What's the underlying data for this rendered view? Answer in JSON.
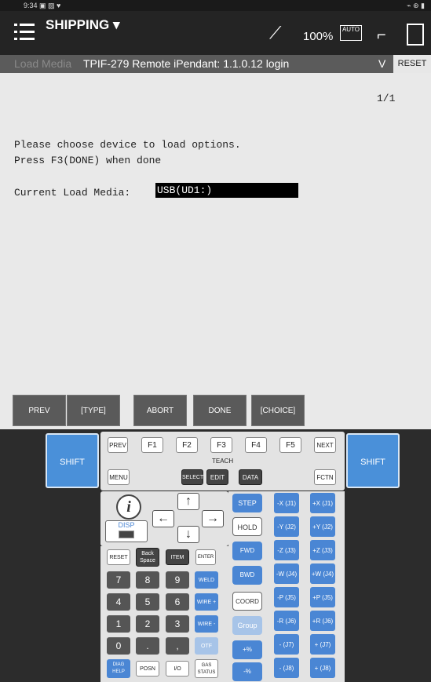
{
  "status_bar": {
    "time": "9:34",
    "left_icons": "▣ ▨ ♥",
    "right_icons": "⌁ ⊛ ▮"
  },
  "header": {
    "program": "SHIPPING",
    "override": "100%",
    "auto_label": "AUTO"
  },
  "subheader": {
    "menu_label": "Load Media",
    "title": "TPIF-279  Remote iPendant: 1.1.0.12 login",
    "dropdown": "V",
    "reset": "RESET"
  },
  "screen": {
    "page_indicator": "1/1",
    "line1": "Please choose device to load options.",
    "line2": "Press F3(DONE) when done",
    "media_label": "Current Load Media:",
    "media_value": "USB(UD1:)"
  },
  "function_keys": [
    "PREV",
    "[TYPE]",
    "ABORT",
    "DONE",
    "[CHOICE]"
  ],
  "keypad": {
    "shift": "SHIFT",
    "top_row": [
      "PREV",
      "F1",
      "F2",
      "F3",
      "F4",
      "F5",
      "NEXT"
    ],
    "menu": "MENU",
    "teach": "TEACH",
    "select": "SELECT",
    "edit": "EDIT",
    "data": "DATA",
    "fctn": "FCTN",
    "info": "i",
    "disp": "DISP",
    "motion": {
      "step": "STEP",
      "hold": "HOLD",
      "fwd": "FWD",
      "bwd": "BWD",
      "coord": "COORD",
      "group": "Group",
      "speed_up": "+%",
      "speed_down": "-%"
    },
    "func_row": [
      "RESET",
      "Back Space",
      "ITEM",
      "ENTER"
    ],
    "numbers": [
      "7",
      "8",
      "9",
      "4",
      "5",
      "6",
      "1",
      "2",
      "3",
      "0",
      ".",
      ","
    ],
    "blue_col": [
      "WELD",
      "WIRE +",
      "WIRE -",
      "OTF"
    ],
    "bottom_row": [
      "DIAG HELP",
      "POSN",
      "I/O",
      "GAS STATUS"
    ],
    "jog_minus": [
      "-X (J1)",
      "-Y (J2)",
      "-Z (J3)",
      "-W (J4)",
      "-P (J5)",
      "-R (J6)",
      "- (J7)",
      "- (J8)"
    ],
    "jog_plus": [
      "+X (J1)",
      "+Y (J2)",
      "+Z (J3)",
      "+W (J4)",
      "+P (J5)",
      "+R (J6)",
      "+ (J7)",
      "+ (J8)"
    ]
  }
}
